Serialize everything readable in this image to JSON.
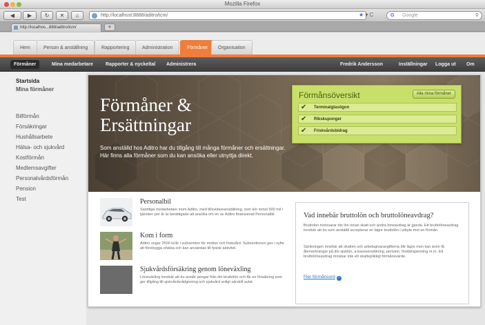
{
  "window": {
    "title": "Mozilla Firefox"
  },
  "browser": {
    "url": "http://localhost:8888/aditro/tcm/",
    "search_placeholder": "Google",
    "search_engine_icon": "G",
    "tab_label": "http://localhos...888/aditro/tcm/",
    "new_tab": "+"
  },
  "app_tabs": [
    "Hem",
    "Person & anställning",
    "Rapportering",
    "Administration",
    "Förmåner",
    "Organisation"
  ],
  "active_app_tab": "Förmåner",
  "subnav": {
    "left": [
      "Förmåner",
      "Mina medarbetare",
      "Rapporter & nyckeltal",
      "Administrera"
    ],
    "right": [
      "Fredrik Andersson",
      "Inställningar",
      "Logga ut",
      "Om"
    ]
  },
  "sidebar": {
    "items": [
      "Startsida",
      "Mina förmåner",
      "Bilförmån",
      "Försäkringar",
      "Hushållsarbete",
      "Hälsa- och sjukvård",
      "Kostförmån",
      "Medlemsavgifter",
      "Personalvårdsförmån",
      "Pension",
      "Test"
    ],
    "active": "Startsida"
  },
  "hero": {
    "title_line1": "Förmåner &",
    "title_line2": "Ersättningar",
    "text": "Som anställd hos Aditro har du tillgång till många förmåner och ersättningar. Här finns alla förmåner som du kan ansöka eller utnyttja direkt."
  },
  "overview": {
    "title": "Förmånsöversikt",
    "button": "Alla mina förmåner",
    "items": [
      "Terminalglasögon",
      "Rikskuponger",
      "Friskvårdsbidrag"
    ]
  },
  "benefits": [
    {
      "title": "Personalbil",
      "desc": "Samtliga medarbetare inom Aditro, med tillsvidareanställning, som kör minst 500 mil i tjänsten per år är berättigade att ansöka om en av Aditro finansierad Personalbil."
    },
    {
      "title": "Kom i form",
      "desc": "Aditro unger 2500 kr/år i subvention för motion och friskvård. Subventionen ges i syfte att förebygga ohälsa och kan användas till fysisk aktivitet."
    },
    {
      "title": "Sjukvårdsförsäkring genom löneväxling",
      "desc": "Löneväxling innebär att du avstår pengar från din bruttolön och får en försäkring som ger tillgång till sjukvårdsrådgivning och sjukvård enligt särskilt avtal."
    }
  ],
  "info": {
    "title": "Vad innebär bruttolön och bruttolöneavdrag?",
    "p1": "Bruttolön motsvarar din lön innan skatt och andra löneavdrag är gjorda. Ett bruttolöneavdrag innebär att du som anställd accepterar en lägre bruttolön i utbyte mot en förmån.",
    "p2": "Sänkningen innebär att skatten och arbetsgivaravgifterna blir lägre men kan även få återverkningar på din sjuklön, a-kasseersättning, pension, föräldrapenning m.m. Ett bruttolöneavdrag minskar inte ett skattepliktigt förmånsvärde.",
    "link": "Fler förmånsord"
  },
  "colors": {
    "accent": "#ef7d3b",
    "overview_bg": "#c8e06a",
    "subnav_bg": "#3c3c3c"
  }
}
